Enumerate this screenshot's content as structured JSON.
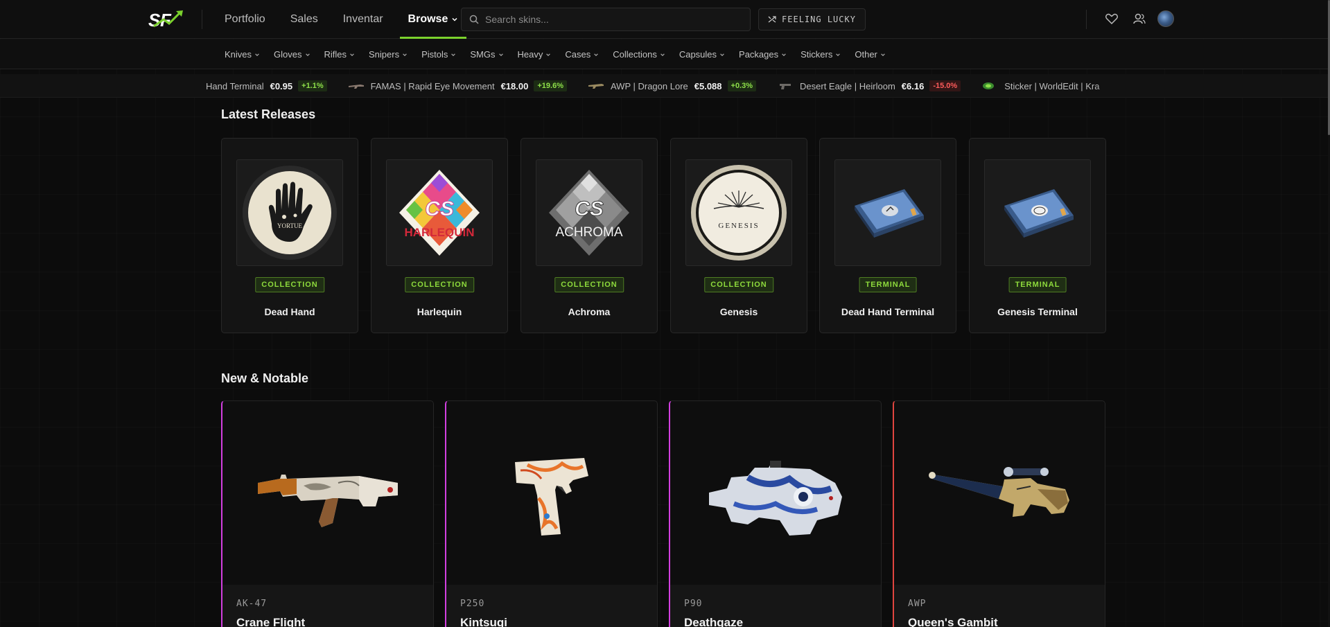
{
  "nav": {
    "links": [
      {
        "label": "Portfolio",
        "active": false
      },
      {
        "label": "Sales",
        "active": false
      },
      {
        "label": "Inventar",
        "active": false
      },
      {
        "label": "Browse",
        "active": true
      }
    ],
    "search_placeholder": "Search skins...",
    "lucky_label": "FEELING LUCKY",
    "icons": [
      "heart-icon",
      "user-icon",
      "avatar"
    ]
  },
  "categories": [
    "Knives",
    "Gloves",
    "Rifles",
    "Snipers",
    "Pistols",
    "SMGs",
    "Heavy",
    "Cases",
    "Collections",
    "Capsules",
    "Packages",
    "Stickers",
    "Other"
  ],
  "ticker": [
    {
      "name": "Dead Hand Terminal",
      "display_name": "Hand Terminal",
      "price": "€0.95",
      "change": "+1.1%",
      "dir": "up"
    },
    {
      "name": "FAMAS | Rapid Eye Movement",
      "price": "€18.00",
      "change": "+19.6%",
      "dir": "up"
    },
    {
      "name": "AWP | Dragon Lore",
      "price": "€5.088",
      "change": "+0.3%",
      "dir": "up"
    },
    {
      "name": "Desert Eagle | Heirloom",
      "price": "€6.16",
      "change": "-15.0%",
      "dir": "down"
    },
    {
      "name": "Sticker | WorldEdit | Kra",
      "price": "",
      "change": "",
      "dir": ""
    }
  ],
  "latest_releases": {
    "title": "Latest Releases",
    "items": [
      {
        "badge": "COLLECTION",
        "name": "Dead Hand",
        "art": "deadhand"
      },
      {
        "badge": "COLLECTION",
        "name": "Harlequin",
        "art": "harlequin",
        "art_text": "HARLEQUIN"
      },
      {
        "badge": "COLLECTION",
        "name": "Achroma",
        "art": "achroma",
        "art_text": "ACHROMA"
      },
      {
        "badge": "COLLECTION",
        "name": "Genesis",
        "art": "genesis",
        "art_text": "GENESIS"
      },
      {
        "badge": "TERMINAL",
        "name": "Dead Hand Terminal",
        "art": "terminal"
      },
      {
        "badge": "TERMINAL",
        "name": "Genesis Terminal",
        "art": "terminal2"
      }
    ]
  },
  "new_notable": {
    "title": "New & Notable",
    "items": [
      {
        "weapon": "AK-47",
        "name": "Crane Flight",
        "rarity_color": "#d33fe0"
      },
      {
        "weapon": "P250",
        "name": "Kintsugi",
        "rarity_color": "#d33fe0"
      },
      {
        "weapon": "P90",
        "name": "Deathgaze",
        "rarity_color": "#d33fe0"
      },
      {
        "weapon": "AWP",
        "name": "Queen's Gambit",
        "rarity_color": "#e0453f"
      }
    ]
  },
  "colors": {
    "accent": "#7bd22d",
    "background": "#0c0c0c",
    "up": "#8ee04a",
    "down": "#ff5b5b"
  }
}
